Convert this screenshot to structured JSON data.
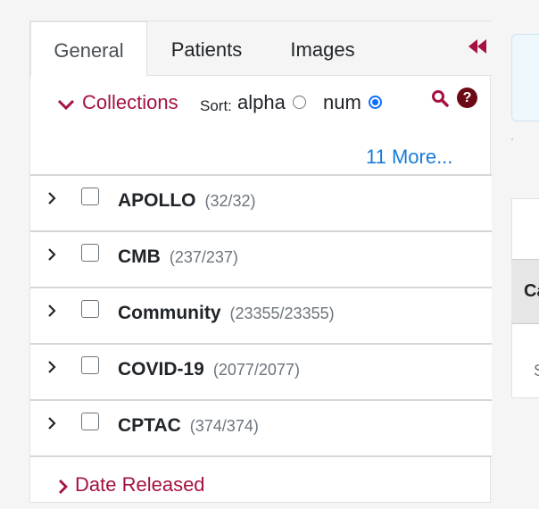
{
  "tabs": [
    {
      "label": "General",
      "active": true
    },
    {
      "label": "Patients",
      "active": false
    },
    {
      "label": "Images",
      "active": false
    }
  ],
  "collections": {
    "label": "Collections",
    "sort_label": "Sort:",
    "sort_options": [
      {
        "label": "alpha",
        "checked": false
      },
      {
        "label": "num",
        "checked": true
      }
    ],
    "more_link": "11 More...",
    "items": [
      {
        "name": "APOLLO",
        "count": "(32/32)"
      },
      {
        "name": "CMB",
        "count": "(237/237)"
      },
      {
        "name": "Community",
        "count": "(23355/23355)"
      },
      {
        "name": "COVID-19",
        "count": "(2077/2077)"
      },
      {
        "name": "CPTAC",
        "count": "(374/374)"
      }
    ]
  },
  "date_released": {
    "label": "Date Released"
  },
  "right": {
    "header_partial": "Ca",
    "cell_partial": "S"
  },
  "colors": {
    "accent": "#a4123f",
    "link": "#1a7bd6",
    "radio": "#0d6efd"
  },
  "icons": [
    "double-chevron-left-icon",
    "chevron-down-icon",
    "search-icon",
    "help-icon",
    "chevron-right-icon"
  ]
}
